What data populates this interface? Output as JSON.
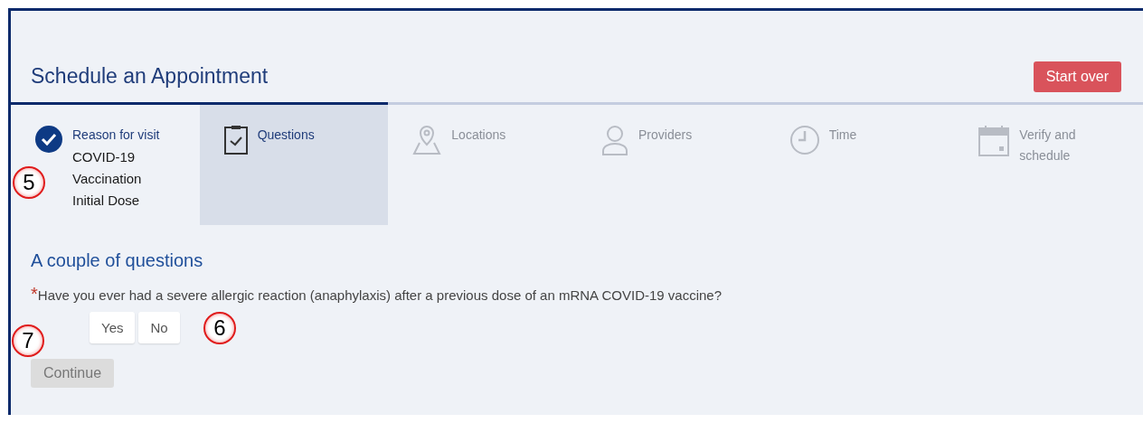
{
  "header": {
    "title": "Schedule an Appointment",
    "start_over": "Start over"
  },
  "steps": [
    {
      "label": "Reason for visit",
      "kind": "done",
      "selected": false,
      "detail": "COVID-19 Vaccination Initial Dose",
      "callout": "5"
    },
    {
      "label": "Questions",
      "kind": "current",
      "selected": true
    },
    {
      "label": "Locations",
      "kind": "upcoming",
      "selected": false
    },
    {
      "label": "Providers",
      "kind": "upcoming",
      "selected": false
    },
    {
      "label": "Time",
      "kind": "upcoming",
      "selected": false
    },
    {
      "label": "Verify and schedule",
      "kind": "upcoming",
      "selected": false
    }
  ],
  "section": {
    "title": "A couple of questions",
    "question": {
      "required_mark": "*",
      "text": "Have you ever had a severe allergic reaction (anaphylaxis) after a previous dose of an mRNA COVID-19 vaccine?",
      "answers": [
        {
          "label": "Yes",
          "selected": false
        },
        {
          "label": "No",
          "selected": false
        }
      ],
      "callout": "6"
    },
    "continue": {
      "label": "Continue",
      "disabled": true,
      "callout": "7"
    }
  }
}
